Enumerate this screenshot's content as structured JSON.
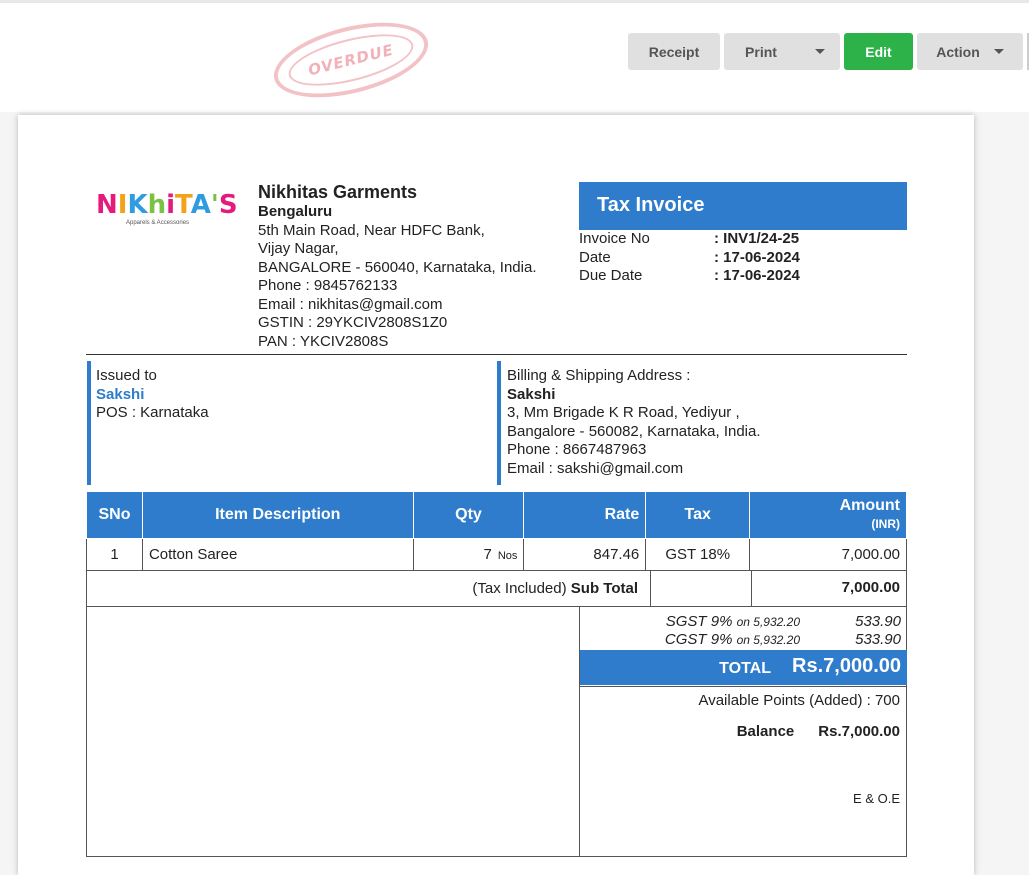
{
  "stamp": {
    "text": "OVERDUE"
  },
  "toolbar": {
    "receipt": "Receipt",
    "print": "Print",
    "edit": "Edit",
    "action": "Action"
  },
  "colors": {
    "accent": "#2f7ccc",
    "edit": "#2db24a",
    "stamp": "#f0a4ac"
  },
  "logo": {
    "letters": [
      "N",
      "I",
      "K",
      "h",
      "i",
      "T",
      "A",
      "'",
      "S"
    ],
    "colors": [
      "#e6197d",
      "#f5a21b",
      "#2f9be0",
      "#7bc142",
      "#e6197d",
      "#f5a21b",
      "#2f9be0",
      "#7bc142",
      "#e6197d"
    ],
    "tagline": "Apparels & Accessories"
  },
  "company": {
    "name": "Nikhitas Garments",
    "city": "Bengaluru",
    "lines": [
      "5th Main Road, Near HDFC Bank,",
      "Vijay Nagar,",
      "BANGALORE - 560040, Karnataka, India.",
      "Phone : 9845762133",
      "Email : nikhitas@gmail.com",
      "GSTIN : 29YKCIV2808S1Z0",
      "PAN : YKCIV2808S"
    ]
  },
  "invoice": {
    "title": "Tax Invoice",
    "meta": [
      {
        "label": "Invoice No",
        "value": ": INV1/24-25"
      },
      {
        "label": "Date",
        "value": ": 17-06-2024"
      },
      {
        "label": "Due Date",
        "value": ": 17-06-2024"
      }
    ]
  },
  "issued": {
    "label": "Issued to",
    "name": "Sakshi",
    "pos": "POS : Karnataka"
  },
  "billing": {
    "label": "Billing & Shipping Address :",
    "name": "Sakshi",
    "lines": [
      "3, Mm Brigade K R Road, Yediyur ,",
      "Bangalore - 560082, Karnataka, India.",
      "Phone : 8667487963",
      "Email : sakshi@gmail.com"
    ]
  },
  "table": {
    "headers": {
      "sno": "SNo",
      "desc": "Item Description",
      "qty": "Qty",
      "rate": "Rate",
      "tax": "Tax",
      "amount": "Amount",
      "amount_unit": "(INR)"
    },
    "rows": [
      {
        "sno": "1",
        "desc": "Cotton Saree",
        "qty": "7",
        "unit": "Nos",
        "rate": "847.46",
        "tax": "GST 18%",
        "amount": "7,000.00"
      }
    ],
    "subtotal_prefix": "(Tax Included) ",
    "subtotal_label": "Sub Total",
    "subtotal_value": "7,000.00"
  },
  "totals": {
    "sgst_label": "SGST 9%",
    "sgst_on": "on 5,932.20",
    "sgst_value": "533.90",
    "cgst_label": "CGST 9%",
    "cgst_on": "on 5,932.20",
    "cgst_value": "533.90",
    "total_label": "TOTAL",
    "total_value": "Rs.7,000.00",
    "points": "Available Points (Added) : 700",
    "balance_label": "Balance",
    "balance_value": "Rs.7,000.00",
    "eoe": "E & O.E"
  }
}
